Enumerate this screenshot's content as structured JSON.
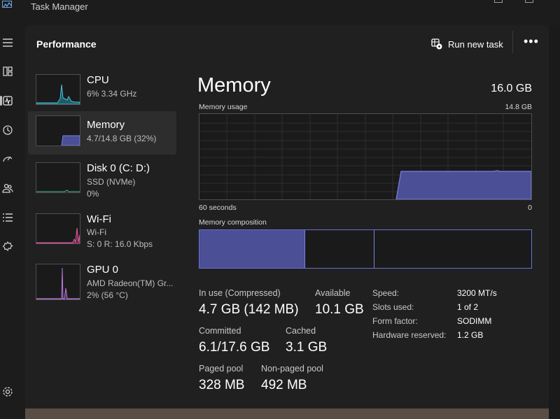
{
  "window": {
    "title": "Task Manager",
    "icon": "task-manager-icon"
  },
  "rail": {
    "items": [
      {
        "icon": "hamburger-icon"
      },
      {
        "icon": "processes-icon"
      },
      {
        "icon": "performance-icon"
      },
      {
        "icon": "app-history-icon"
      },
      {
        "icon": "startup-apps-icon"
      },
      {
        "icon": "users-icon"
      },
      {
        "icon": "details-icon"
      },
      {
        "icon": "services-icon"
      },
      {
        "icon": "settings-icon"
      }
    ]
  },
  "header": {
    "title": "Performance",
    "run_new_task": "Run new task",
    "more": "•••"
  },
  "sidebar": {
    "items": [
      {
        "name": "CPU",
        "sub1": "6%  3.34 GHz",
        "sub2": "",
        "sub3": "",
        "color": "#4cc2d9",
        "selected": false
      },
      {
        "name": "Memory",
        "sub1": "4.7/14.8 GB (32%)",
        "sub2": "",
        "sub3": "",
        "color": "#7a80e6",
        "selected": true
      },
      {
        "name": "Disk 0 (C: D:)",
        "sub1": "SSD (NVMe)",
        "sub2": "0%",
        "sub3": "",
        "color": "#4cc28a",
        "selected": false
      },
      {
        "name": "Wi-Fi",
        "sub1": "Wi-Fi",
        "sub2": "S: 0 R: 16.0 Kbps",
        "sub3": "",
        "color": "#e05aa0",
        "selected": false
      },
      {
        "name": "GPU 0",
        "sub1": "AMD Radeon(TM) Gr...",
        "sub2": "2%  (56 °C)",
        "sub3": "",
        "color": "#b57ad9",
        "selected": false
      }
    ]
  },
  "memory": {
    "title": "Memory",
    "total": "16.0 GB",
    "usage_label": "Memory usage",
    "usage_max": "14.8 GB",
    "time_left": "60 seconds",
    "time_right": "0",
    "composition_label": "Memory composition",
    "usage_fraction": 0.32,
    "stats": {
      "in_use_label": "In use (Compressed)",
      "in_use_value": "4.7 GB (142 MB)",
      "available_label": "Available",
      "available_value": "10.1 GB",
      "committed_label": "Committed",
      "committed_value": "6.1/17.6 GB",
      "cached_label": "Cached",
      "cached_value": "3.1 GB",
      "paged_label": "Paged pool",
      "paged_value": "328 MB",
      "nonpaged_label": "Non-paged pool",
      "nonpaged_value": "492 MB"
    },
    "specs": [
      {
        "label": "Speed:",
        "value": "3200 MT/s"
      },
      {
        "label": "Slots used:",
        "value": "1 of 2"
      },
      {
        "label": "Form factor:",
        "value": "SODIMM"
      },
      {
        "label": "Hardware reserved:",
        "value": "1.2 GB"
      }
    ]
  },
  "colors": {
    "accent": "#7a80e6",
    "memory_fill": "#4a4f96",
    "background": "#202020"
  }
}
